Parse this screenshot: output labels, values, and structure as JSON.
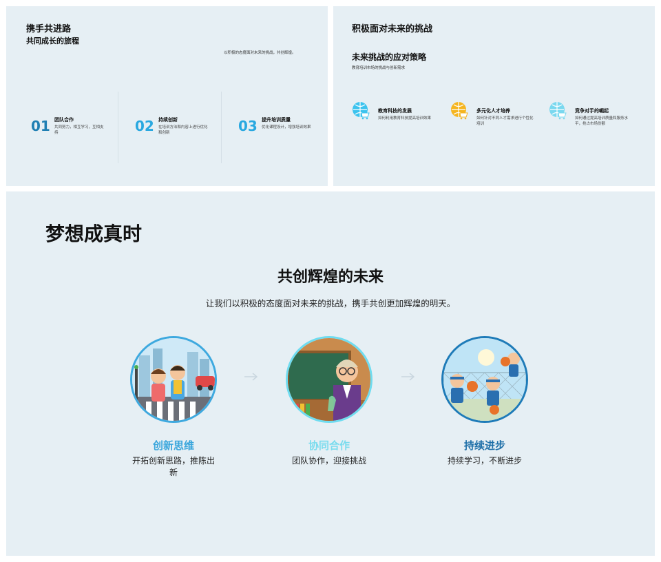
{
  "slide1": {
    "title": "携手共进路",
    "subtitle": "共同成长的旅程",
    "description": "以积极的态度面对未来的挑战，共创辉煌。",
    "columns": [
      {
        "number": "01",
        "title": "团队合作",
        "desc": "共同努力，相互学习，互相支持"
      },
      {
        "number": "02",
        "title": "持续创新",
        "desc": "在培训方法和内容上进行优化和创新"
      },
      {
        "number": "03",
        "title": "提升培训质量",
        "desc": "优化课程设计，增强培训效果"
      }
    ]
  },
  "slide2": {
    "title": "积极面对未来的挑战",
    "subtitle": "未来挑战的应对策略",
    "description": "教育培训市场的挑战与创新需求",
    "items": [
      {
        "icon": "cart-globe-icon",
        "color": "#3cc3ee",
        "title": "教育科技的发展",
        "desc": "如何利用教育科技提高培训效果"
      },
      {
        "icon": "cart-globe-icon",
        "color": "#f5b520",
        "title": "多元化人才培养",
        "desc": "如何针对不同人才需求进行个性化培训"
      },
      {
        "icon": "cart-globe-icon",
        "color": "#7ad8ef",
        "title": "竞争对手的崛起",
        "desc": "如何通过提高培训质量和服务水平，抢占市场份额"
      }
    ]
  },
  "slide3": {
    "title": "梦想成真时",
    "subtitle": "共创辉煌的未来",
    "description": "让我们以积极的态度面对未来的挑战，携手共创更加辉煌的明天。",
    "cards": [
      {
        "title": "创新思维",
        "desc": "开拓创新思路，推陈出新",
        "image": "kids-crossing-street-illustration"
      },
      {
        "title": "协同合作",
        "desc": "团队协作，迎接挑战",
        "image": "teacher-chalkboard-illustration"
      },
      {
        "title": "持续进步",
        "desc": "持续学习，不断进步",
        "image": "kids-basketball-illustration"
      }
    ]
  },
  "colors": {
    "slide_bg": "#e6eff4",
    "accent_dark": "#1f7fb3",
    "accent": "#29a8e0",
    "accent_light": "#7bdcee"
  }
}
